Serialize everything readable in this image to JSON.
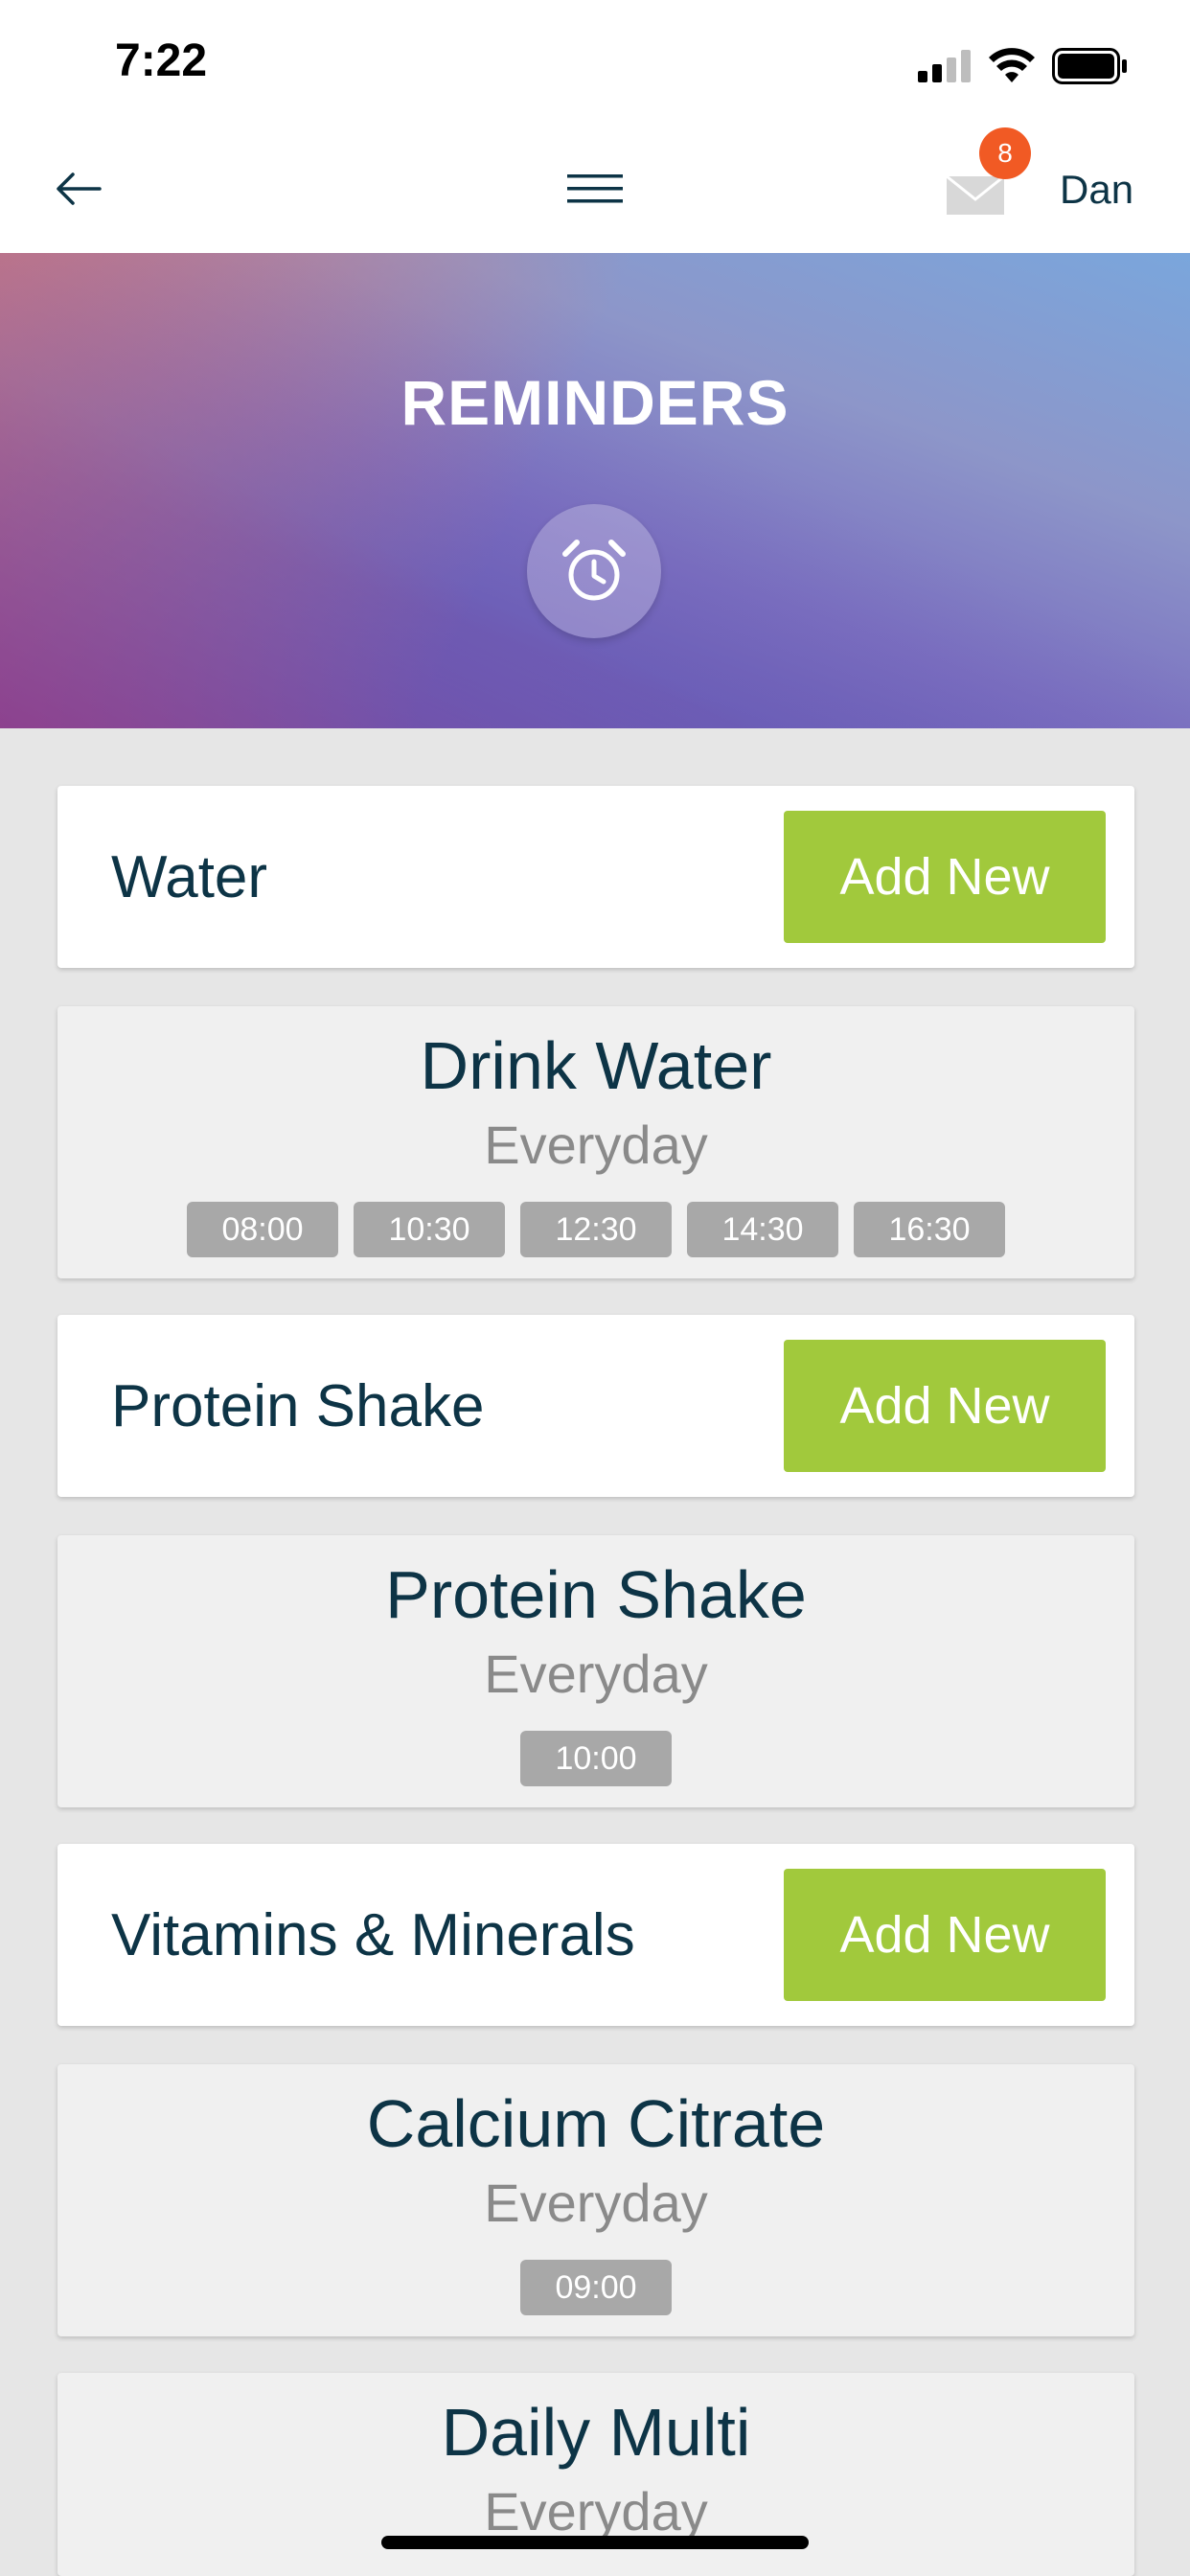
{
  "status_bar": {
    "time": "7:22"
  },
  "nav": {
    "mail_badge": "8",
    "user_name": "Dan"
  },
  "header": {
    "title": "REMINDERS",
    "icon": "alarm-clock-icon"
  },
  "sections": [
    {
      "title": "Water",
      "add_label": "Add New",
      "items": [
        {
          "name": "Drink Water",
          "frequency": "Everyday",
          "times": [
            "08:00",
            "10:30",
            "12:30",
            "14:30",
            "16:30"
          ]
        }
      ]
    },
    {
      "title": "Protein Shake",
      "add_label": "Add New",
      "items": [
        {
          "name": "Protein Shake",
          "frequency": "Everyday",
          "times": [
            "10:00"
          ]
        }
      ]
    },
    {
      "title": "Vitamins & Minerals",
      "add_label": "Add New",
      "items": [
        {
          "name": "Calcium Citrate",
          "frequency": "Everyday",
          "times": [
            "09:00"
          ]
        },
        {
          "name": "Daily Multi",
          "frequency": "Everyday",
          "times": []
        }
      ]
    }
  ],
  "colors": {
    "accent": "#a1c93c",
    "text": "#0d3446",
    "badge": "#f15a24",
    "chip": "#a8a8a8"
  }
}
